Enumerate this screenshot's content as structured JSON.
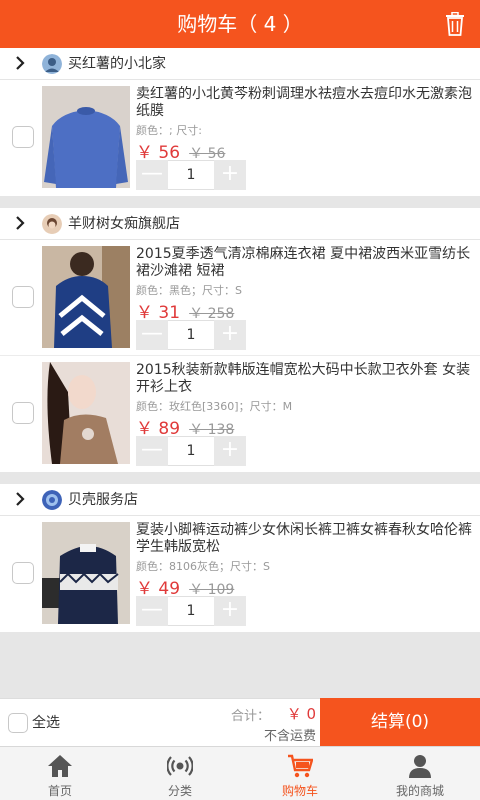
{
  "header": {
    "title": "购物车（ 4 ）"
  },
  "shops": [
    {
      "name": "买红薯的小北家",
      "items": [
        {
          "title": "卖红薯的小北黄芩粉刺调理水祛痘水去痘印水无激素泡纸膜",
          "attrs": "颜色：; 尺寸:",
          "price": "￥ 56",
          "old_price": "￥ 56",
          "qty": "1"
        }
      ]
    },
    {
      "name": "羊财树女痴旗舰店",
      "items": [
        {
          "title": "2015夏季透气清凉棉麻连衣裙 夏中裙波西米亚雪纺长裙沙滩裙 短裙",
          "attrs": "颜色：黑色；尺寸：S",
          "price": "￥ 31",
          "old_price": "￥ 258",
          "qty": "1"
        },
        {
          "title": "2015秋装新款韩版连帽宽松大码中长款卫衣外套 女装开衫上衣",
          "attrs": "颜色：玫红色[3360]；尺寸：M",
          "price": "￥ 89",
          "old_price": "￥ 138",
          "qty": "1"
        }
      ]
    },
    {
      "name": "贝壳服务店",
      "items": [
        {
          "title": "夏装小脚裤运动裤少女休闲长裤卫裤女裤春秋女哈伦裤学生韩版宽松",
          "attrs": "颜色：8106灰色；尺寸：S",
          "price": "￥ 49",
          "old_price": "￥ 109",
          "qty": "1"
        }
      ]
    }
  ],
  "stepper": {
    "minus": "—",
    "plus": "+"
  },
  "bottom": {
    "select_all": "全选",
    "total_label": "合计：",
    "total_value": "￥ 0",
    "shipping": "不含运费",
    "checkout": "结算(0)"
  },
  "tabs": [
    {
      "label": "首页",
      "icon": "home-icon"
    },
    {
      "label": "分类",
      "icon": "broadcast-icon"
    },
    {
      "label": "购物车",
      "icon": "cart-icon"
    },
    {
      "label": "我的商城",
      "icon": "user-icon"
    }
  ],
  "colors": {
    "accent": "#f5541e",
    "price": "#e03a3a"
  }
}
